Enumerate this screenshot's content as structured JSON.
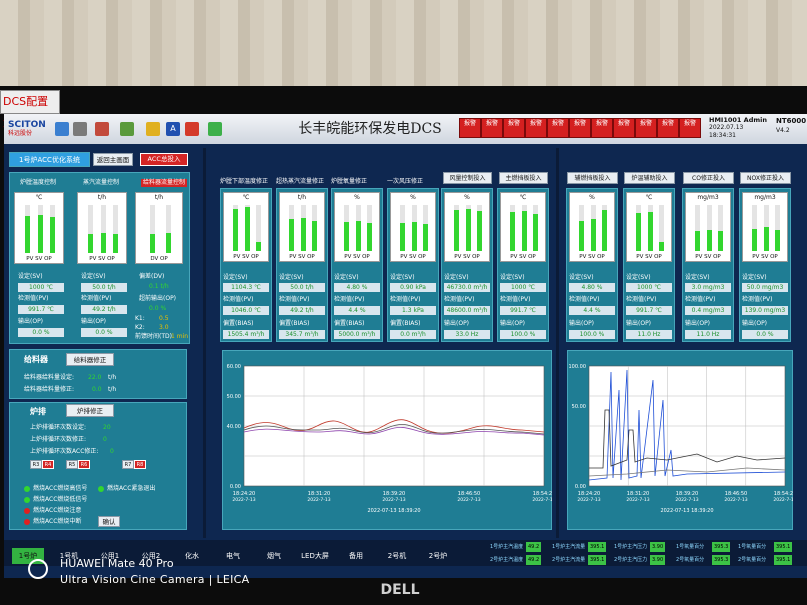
{
  "window_tab": "DCS配置站",
  "header": {
    "logo_text": "SCITON",
    "logo_sub": "科远股份",
    "title": "长丰皖能环保发电DCS",
    "alarm_labels": [
      "报警",
      "报警",
      "报警",
      "报警",
      "报警",
      "报警",
      "报警",
      "报警",
      "报警",
      "报警",
      "报警"
    ],
    "user": "HMI1001  Admin",
    "date": "2022.07.13 18:34:31",
    "node": "NT6000",
    "node_sub": "V4.2"
  },
  "left": {
    "system_title": "1号炉ACC优化系统",
    "return_btn": "返回主画面",
    "acc_btn": "ACC总投入",
    "groups": [
      {
        "title": "炉膛温度控制",
        "unit": "℃",
        "sv_label": "设定(SV)",
        "sv": "1000",
        "sv_unit": "℃",
        "pv_label": "检测值(PV)",
        "pv": "991.7",
        "pv_unit": "℃",
        "op_label": "输出(OP)",
        "op": "0.0",
        "op_unit": "%",
        "bars": [
          0.78,
          0.8,
          0.74
        ],
        "caps": "PV SV OP"
      },
      {
        "title": "蒸汽流量控制",
        "unit": "t/h",
        "sv_label": "设定(SV)",
        "sv": "50.0",
        "sv_unit": "t/h",
        "pv_label": "检测值(PV)",
        "pv": "49.2",
        "pv_unit": "t/h",
        "op_label": "输出(OP)",
        "op": "0.0",
        "op_unit": "%",
        "bars": [
          0.4,
          0.42,
          0.4
        ],
        "caps": "PV SV OP"
      },
      {
        "title": "给料器流量控制",
        "unit": "t/h",
        "dev_label": "偏差(DV)",
        "dev": "0.1",
        "dev_unit": "t/h",
        "kop_label": "超前输出(OP)",
        "kop": "0.0",
        "kop_unit": "%",
        "k1_label": "K1:",
        "k1": "0.5",
        "k2_label": "K2:",
        "k2": "3.0",
        "time_label": "前馈时间(TD)",
        "time": "1",
        "time_unit": "min",
        "bars": [
          0.4,
          0.42
        ],
        "caps": "DV OP"
      }
    ],
    "feeder": {
      "title": "给料器",
      "btn": "给料器修正",
      "row1_label": "给料器给料量设定:",
      "row1_val": "22.0",
      "row1_unit": "t/h",
      "row2_label": "给料器给料量修正:",
      "row2_val": "0.0",
      "row2_unit": "t/h"
    },
    "grate": {
      "title": "炉排",
      "btn": "炉排修正",
      "row1_label": "上炉排循环次数设定:",
      "row1_val": "20",
      "row2_label": "上炉排循环次数修正:",
      "row2_val": "0",
      "row3_label": "上炉排循环次数ACC修正:",
      "row3_val": "0",
      "small_btns": [
        "R3",
        "R4",
        "R5",
        "R6",
        "R7",
        "R8"
      ]
    },
    "legend": [
      "燃烧ACC燃烧高信号",
      "燃烧ACC紧急退出",
      "燃烧ACC燃烧低信号",
      "燃烧ACC燃烧注意",
      "燃烧ACC燃烧中断"
    ],
    "confirm_btn": "确认"
  },
  "mid": {
    "columns": [
      {
        "title": "炉膛下部温度修正",
        "unit": "℃",
        "bars": [
          0.92,
          0.95,
          0.2
        ],
        "sv": "1104.3",
        "sv_unit": "℃",
        "pv": "1046.0",
        "pv_unit": "℃",
        "dev_label": "偏置(BIAS)",
        "dev": "1505.4",
        "dev_unit": "m³/h"
      },
      {
        "title": "超热蒸汽流量修正",
        "unit": "t/h",
        "bars": [
          0.7,
          0.72,
          0.65
        ],
        "sv": "50.0",
        "sv_unit": "t/h",
        "pv": "49.2",
        "pv_unit": "t/h",
        "dev_label": "偏置(BIAS)",
        "dev": "345.7",
        "dev_unit": "m³/h"
      },
      {
        "title": "炉膛氧量修正",
        "unit": "%",
        "bars": [
          0.62,
          0.66,
          0.6
        ],
        "sv": "4.80",
        "sv_unit": "%",
        "pv": "4.4",
        "pv_unit": "%",
        "dev_label": "偏置(BIAS)",
        "dev": "5000.0",
        "dev_unit": "m³/h"
      },
      {
        "title": "一次风压修正",
        "unit": "%",
        "bars": [
          0.6,
          0.62,
          0.58
        ],
        "sv": "0.90",
        "sv_unit": "kPa",
        "pv": "1.3",
        "pv_unit": "kPa",
        "dev_label": "偏置(BIAS)",
        "dev": "0.0",
        "dev_unit": "m³/h"
      },
      {
        "title": "风量控制投入",
        "unit": "%",
        "bars": [
          0.9,
          0.92,
          0.88
        ],
        "sv": "46730.0",
        "sv_unit": "m³/h",
        "pv": "48600.0",
        "pv_unit": "m³/h",
        "dev_label": "输出(OP)",
        "dev": "33.0",
        "dev_unit": "Hz"
      },
      {
        "title": "主燃挡板投入",
        "unit": "℃",
        "bars": [
          0.85,
          0.88,
          0.8
        ],
        "sv": "1000",
        "sv_unit": "℃",
        "pv": "991.7",
        "pv_unit": "℃",
        "dev_label": "输出(OP)",
        "dev": "100.0",
        "dev_unit": "%"
      }
    ],
    "labels": {
      "sv": "设定(SV)",
      "pv": "检测值(PV)",
      "caps": "PV SV OP"
    }
  },
  "right": {
    "columns": [
      {
        "title": "辅燃挡板投入",
        "unit": "%",
        "bars": [
          0.66,
          0.7,
          0.9
        ],
        "sv": "4.80",
        "sv_unit": "%",
        "pv": "4.4",
        "pv_unit": "%",
        "op": "100.0",
        "op_unit": "%"
      },
      {
        "title": "炉温辅助投入",
        "unit": "℃",
        "bars": [
          0.82,
          0.84,
          0.2
        ],
        "sv": "1000",
        "sv_unit": "℃",
        "pv": "991.7",
        "pv_unit": "℃",
        "op": "11.0",
        "op_unit": "Hz"
      },
      {
        "title": "CO修正投入",
        "unit": "mg/m3",
        "bars": [
          0.44,
          0.46,
          0.44
        ],
        "sv": "3.0",
        "sv_unit": "mg/m3",
        "pv": "0.4",
        "pv_unit": "mg/m3",
        "op": "11.0",
        "op_unit": "Hz"
      },
      {
        "title": "NOX修正投入",
        "unit": "mg/m3",
        "bars": [
          0.48,
          0.52,
          0.46
        ],
        "sv": "50.0",
        "sv_unit": "mg/m3",
        "pv": "139.0",
        "pv_unit": "mg/m3",
        "op": "0.0",
        "op_unit": "%"
      }
    ],
    "labels": {
      "sv": "设定(SV)",
      "pv": "检测值(PV)",
      "op": "输出(OP)",
      "caps": "PV SV OP"
    }
  },
  "trend_left": {
    "y_ticks": [
      "60.00",
      "50.00",
      "40.00",
      "0.00"
    ],
    "x_ticks": [
      "18:24:20",
      "18:31:20",
      "18:39:20",
      "18:46:50",
      "18:54:20"
    ],
    "x_dates": [
      "2022-7-13",
      "2022-7-13",
      "2022-7-13",
      "2022-7-13",
      "2022-7-13"
    ],
    "footer": "2022-07-13 18:39:20"
  },
  "trend_right": {
    "y_ticks": [
      "100.00",
      "50.00",
      "0.00"
    ],
    "x_ticks": [
      "18:24:20",
      "18:31:20",
      "18:39:20",
      "18:46:50",
      "18:54:20"
    ],
    "x_dates": [
      "2022-7-13",
      "2022-7-13",
      "2022-7-13",
      "2022-7-13",
      "2022-7-13"
    ],
    "footer": "2022-07-13 18:39:20"
  },
  "bottom": {
    "tabs": [
      "1号炉",
      "1号机",
      "公用1",
      "公用2",
      "化水",
      "电气",
      "烟气",
      "LED大屏",
      "备用",
      "2号机",
      "2号炉"
    ],
    "status": [
      {
        "label": "1号炉主汽温度",
        "val": "49.2"
      },
      {
        "label": "1号炉主汽流量",
        "val": "395.1"
      },
      {
        "label": "1号炉主汽压力",
        "val": "3.90"
      },
      {
        "label": "1号氧量百分",
        "val": "395.3"
      },
      {
        "label": "1号氧量百分",
        "val": "395.1"
      }
    ],
    "status2": [
      {
        "label": "2号炉主汽温度",
        "val": "49.2"
      },
      {
        "label": "2号炉主汽流量",
        "val": "395.1"
      },
      {
        "label": "2号炉主汽压力",
        "val": "3.90"
      },
      {
        "label": "2号氧量百分",
        "val": "395.3"
      },
      {
        "label": "2号氧量百分",
        "val": "395.1"
      }
    ]
  },
  "watermark": {
    "line1": "HUAWEI Mate 40 Pro",
    "line2": "Ultra Vision Cine Camera | LEICA"
  },
  "monitor_brand": "DELL"
}
